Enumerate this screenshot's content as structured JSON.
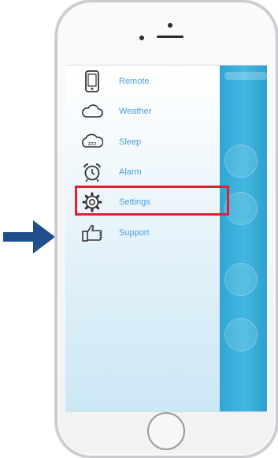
{
  "menu": {
    "items": [
      {
        "label": "Remote",
        "icon": "phone-icon",
        "selected": false
      },
      {
        "label": "Weather",
        "icon": "cloud-icon",
        "selected": false
      },
      {
        "label": "Sleep",
        "icon": "sleep-icon",
        "selected": false
      },
      {
        "label": "Alarm",
        "icon": "alarm-clock-icon",
        "selected": false
      },
      {
        "label": "Settings",
        "icon": "gear-icon",
        "selected": true
      },
      {
        "label": "Support",
        "icon": "thumbs-up-icon",
        "selected": false
      }
    ]
  },
  "colors": {
    "menu_label": "#4a9fd6",
    "highlight": "#e02230",
    "arrow": "#1f4e8c",
    "content_accent": "#3aaedb"
  }
}
